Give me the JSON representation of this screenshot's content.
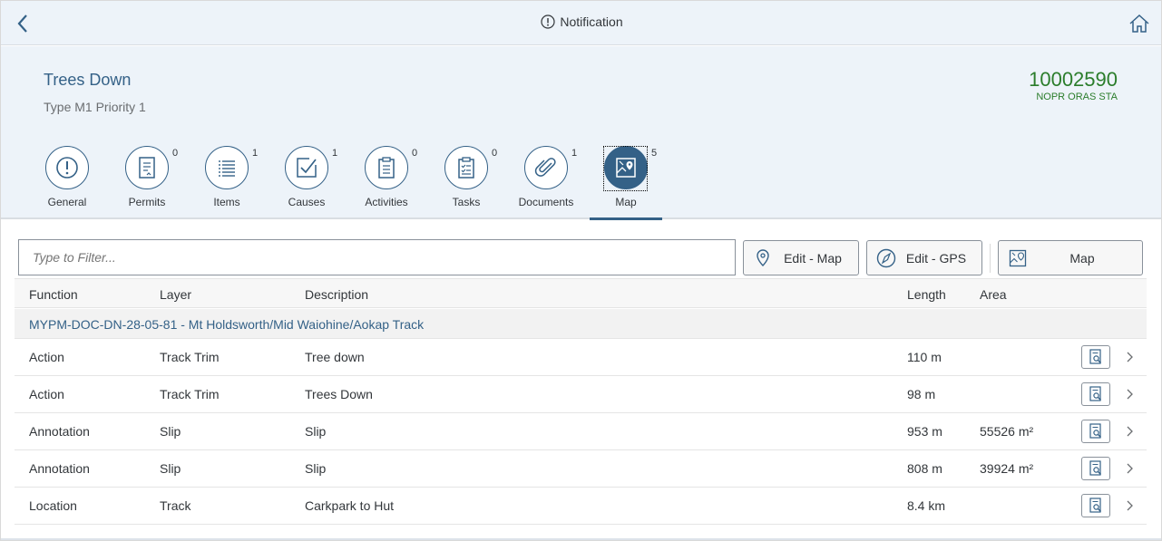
{
  "shell": {
    "title": "Notification",
    "back_icon": "back-chevron-icon",
    "home_icon": "home-icon",
    "title_icon": "exclamation-circle-icon"
  },
  "header": {
    "title": "Trees Down",
    "subtitle": "Type M1 Priority 1",
    "number": "10002590",
    "unit": "NOPR ORAS STA",
    "number_color": "#2b7d2b"
  },
  "tabs": [
    {
      "label": "General",
      "count": "",
      "icon": "exclamation-circle-icon"
    },
    {
      "label": "Permits",
      "count": "0",
      "icon": "permit-document-icon"
    },
    {
      "label": "Items",
      "count": "1",
      "icon": "list-icon"
    },
    {
      "label": "Causes",
      "count": "1",
      "icon": "cause-check-icon"
    },
    {
      "label": "Activities",
      "count": "0",
      "icon": "clipboard-icon"
    },
    {
      "label": "Tasks",
      "count": "0",
      "icon": "task-list-icon"
    },
    {
      "label": "Documents",
      "count": "1",
      "icon": "paperclip-icon"
    },
    {
      "label": "Map",
      "count": "5",
      "icon": "map-icon",
      "active": true
    }
  ],
  "toolbar": {
    "filter_placeholder": "Type to Filter...",
    "edit_map_label": "Edit - Map",
    "edit_gps_label": "Edit - GPS",
    "map_label": "Map"
  },
  "table": {
    "columns": [
      "Function",
      "Layer",
      "Description",
      "Length",
      "Area"
    ],
    "group": "MYPM-DOC-DN-28-05-81 - Mt Holdsworth/Mid Waiohine/Aokap Track",
    "rows": [
      {
        "function": "Action",
        "layer": "Track Trim",
        "description": "Tree down",
        "length": "110 m",
        "area": ""
      },
      {
        "function": "Action",
        "layer": "Track Trim",
        "description": "Trees Down",
        "length": "98 m",
        "area": ""
      },
      {
        "function": "Annotation",
        "layer": "Slip",
        "description": "Slip",
        "length": "953 m",
        "area": "55526 m²"
      },
      {
        "function": "Annotation",
        "layer": "Slip",
        "description": "Slip",
        "length": "808 m",
        "area": "39924 m²"
      },
      {
        "function": "Location",
        "layer": "Track",
        "description": "Carkpark to Hut",
        "length": "8.4 km",
        "area": ""
      }
    ]
  },
  "colors": {
    "accent": "#346187",
    "header_bg": "#edf3f9"
  }
}
